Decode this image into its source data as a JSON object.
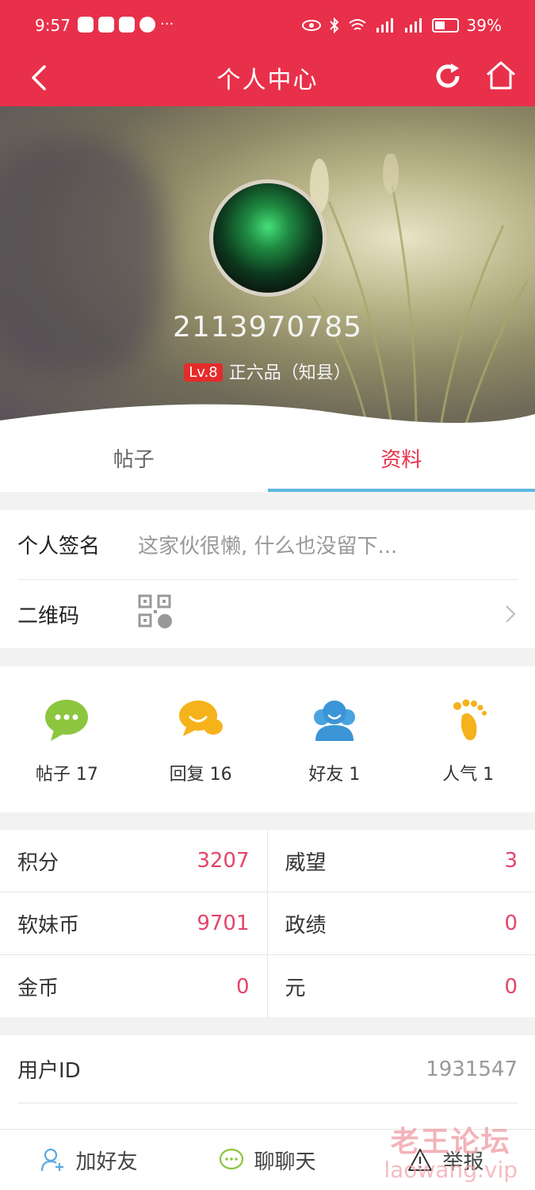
{
  "status_bar": {
    "time": "9:57",
    "battery": "39%"
  },
  "header": {
    "title": "个人中心"
  },
  "profile": {
    "username": "2113970785",
    "level_badge": "Lv.8",
    "rank": "正六品（知县）"
  },
  "tabs": [
    {
      "label": "帖子"
    },
    {
      "label": "资料"
    }
  ],
  "info": {
    "signature_label": "个人签名",
    "signature_value": "这家伙很懒, 什么也没留下...",
    "qrcode_label": "二维码"
  },
  "stats": [
    {
      "label": "帖子 17"
    },
    {
      "label": "回复 16"
    },
    {
      "label": "好友 1"
    },
    {
      "label": "人气 1"
    }
  ],
  "grid": [
    [
      {
        "label": "积分",
        "value": "3207"
      },
      {
        "label": "威望",
        "value": "3"
      }
    ],
    [
      {
        "label": "软妹币",
        "value": "9701"
      },
      {
        "label": "政绩",
        "value": "0"
      }
    ],
    [
      {
        "label": "金币",
        "value": "0"
      },
      {
        "label": "元",
        "value": "0"
      }
    ]
  ],
  "user_id": {
    "label": "用户ID",
    "value": "1931547"
  },
  "bottom_bar": {
    "add_friend": "加好友",
    "chat": "聊聊天",
    "report": "举报"
  },
  "watermark": {
    "line1": "老王论坛",
    "line2": "laowang.vip"
  },
  "colors": {
    "brand": "#e8304a",
    "value_red": "#e2456b",
    "tab_underline": "#5cb8e0"
  }
}
